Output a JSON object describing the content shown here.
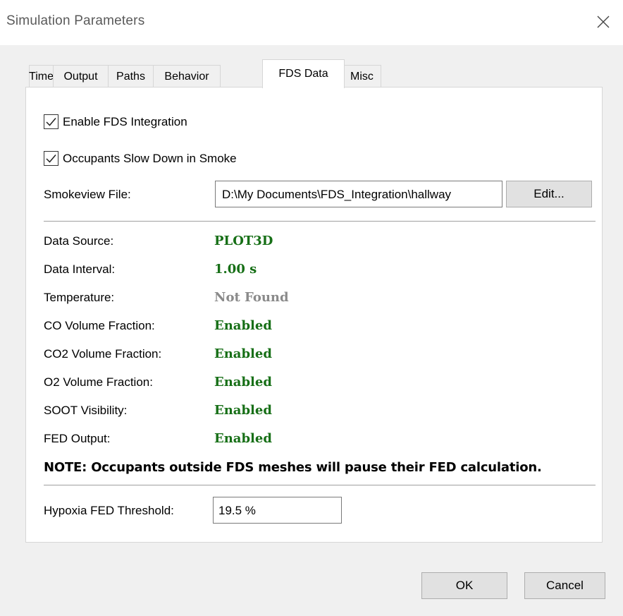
{
  "window": {
    "title": "Simulation Parameters",
    "close_icon": "close-icon"
  },
  "tabs": [
    {
      "label": "Time"
    },
    {
      "label": "Output"
    },
    {
      "label": "Paths"
    },
    {
      "label": "Behavior"
    },
    {
      "label": "FDS Data",
      "active": true
    },
    {
      "label": "Misc"
    }
  ],
  "fds": {
    "enable_label": "Enable FDS Integration",
    "enable_checked": true,
    "slow_label": "Occupants Slow Down in Smoke",
    "slow_checked": true,
    "smokeview_label": "Smokeview File:",
    "smokeview_value": "D:\\My Documents\\FDS_Integration\\hallway",
    "edit_label": "Edit...",
    "rows": [
      {
        "label": "Data Source:",
        "value": "PLOT3D",
        "status": "ok"
      },
      {
        "label": "Data Interval:",
        "value": "1.00 s",
        "status": "ok"
      },
      {
        "label": "Temperature:",
        "value": "Not Found",
        "status": "missing"
      },
      {
        "label": "CO Volume Fraction:",
        "value": "Enabled",
        "status": "ok"
      },
      {
        "label": "CO2 Volume Fraction:",
        "value": "Enabled",
        "status": "ok"
      },
      {
        "label": "O2 Volume Fraction:",
        "value": "Enabled",
        "status": "ok"
      },
      {
        "label": "SOOT Visibility:",
        "value": "Enabled",
        "status": "ok"
      },
      {
        "label": "FED Output:",
        "value": "Enabled",
        "status": "ok"
      }
    ],
    "note": "NOTE: Occupants outside FDS meshes will pause their FED calculation.",
    "threshold_label": "Hypoxia FED Threshold:",
    "threshold_value": "19.5 %"
  },
  "buttons": {
    "ok": "OK",
    "cancel": "Cancel"
  },
  "colors": {
    "ok_green": "#176f17",
    "missing_gray": "#8a8a8a"
  }
}
